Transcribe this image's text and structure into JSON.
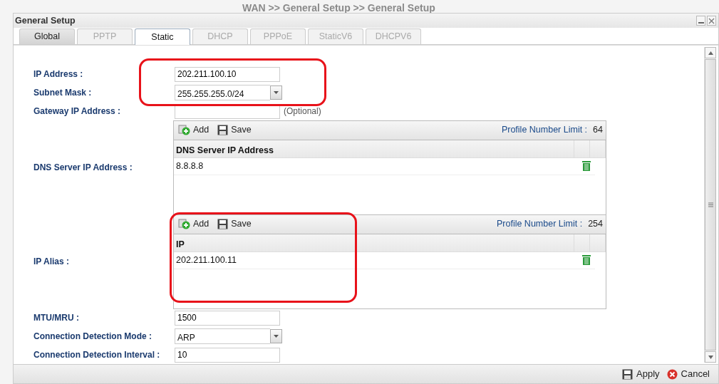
{
  "background_breadcrumb": "WAN >> General Setup >> General Setup",
  "window": {
    "title": "General Setup"
  },
  "tabs": [
    {
      "label": "Global",
      "selected": false,
      "disabled": false
    },
    {
      "label": "PPTP",
      "selected": false,
      "disabled": true
    },
    {
      "label": "Static",
      "selected": true,
      "disabled": false
    },
    {
      "label": "DHCP",
      "selected": false,
      "disabled": true
    },
    {
      "label": "PPPoE",
      "selected": false,
      "disabled": true
    },
    {
      "label": "StaticV6",
      "selected": false,
      "disabled": true
    },
    {
      "label": "DHCPV6",
      "selected": false,
      "disabled": true
    }
  ],
  "fields": [
    {
      "kind": "input",
      "label": "IP Address :",
      "value": "202.211.100.10"
    },
    {
      "kind": "select",
      "label": "Subnet Mask :",
      "value": "255.255.255.0/24"
    },
    {
      "kind": "input",
      "label": "Gateway IP Address :",
      "note": "(Optional)"
    },
    {
      "kind": "table",
      "label": "DNS Server IP Address :",
      "toolbar": [
        "Add",
        "Save"
      ],
      "limit_label": "Profile Number Limit :",
      "limit_value": "64",
      "column": "DNS Server IP Address",
      "rows": [
        "8.8.8.8"
      ]
    },
    {
      "kind": "table",
      "label": "IP Alias :",
      "toolbar": [
        "Add",
        "Save"
      ],
      "limit_label": "Profile Number Limit :",
      "limit_value": "254",
      "column": "IP",
      "rows": [
        "202.211.100.11"
      ]
    },
    {
      "kind": "input",
      "label": "MTU/MRU :",
      "value": "1500"
    },
    {
      "kind": "select",
      "label": "Connection Detection Mode :",
      "value": "ARP"
    },
    {
      "kind": "input",
      "label": "Connection Detection Interval :",
      "value": "10"
    }
  ],
  "footer_buttons": [
    "Apply",
    "Cancel"
  ]
}
